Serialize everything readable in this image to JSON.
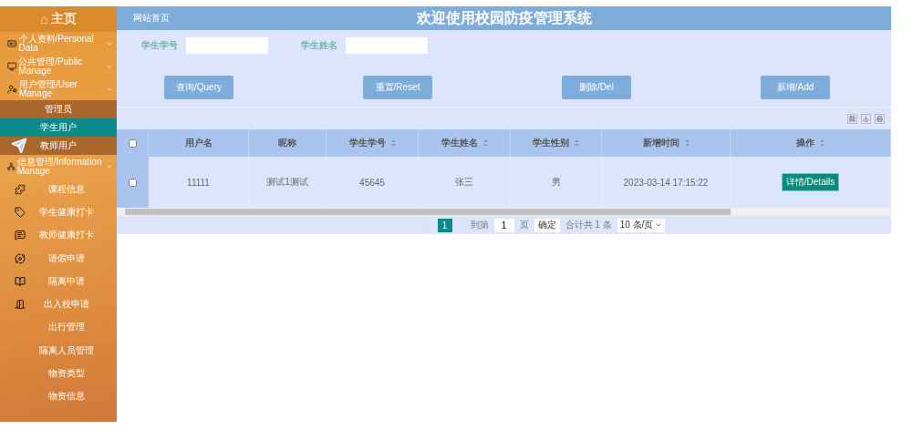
{
  "sidebar": {
    "home": {
      "icon": "⌂",
      "label": "主页"
    },
    "items": [
      {
        "kind": "group",
        "label": "个人资料/Personal Data",
        "expanded": false
      },
      {
        "kind": "group",
        "label": "公共管理/Public Manage",
        "expanded": false
      },
      {
        "kind": "group",
        "label": "用户管理/User Manage",
        "expanded": true,
        "children": [
          {
            "label": "管理员",
            "selected": false
          },
          {
            "label": "学生用户",
            "selected": true
          },
          {
            "label": "教师用户",
            "selected": false
          }
        ]
      },
      {
        "kind": "group",
        "label": "信息管理/Information Manage",
        "expanded": false
      },
      {
        "kind": "item",
        "label": "课程信息"
      },
      {
        "kind": "item",
        "label": "学生健康打卡"
      },
      {
        "kind": "item",
        "label": "教师健康打卡"
      },
      {
        "kind": "item",
        "label": "请假申请"
      },
      {
        "kind": "item",
        "label": "隔离申请"
      },
      {
        "kind": "item",
        "label": "出入校申请"
      },
      {
        "kind": "item",
        "label": "出行管理"
      },
      {
        "kind": "item",
        "label": "隔离人员管理"
      },
      {
        "kind": "item",
        "label": "物资类型"
      },
      {
        "kind": "item",
        "label": "物资信息"
      }
    ]
  },
  "topbar": {
    "breadcrumb": "网站首页",
    "title": "欢迎使用校园防疫管理系统"
  },
  "search": [
    {
      "label": "学生学号"
    },
    {
      "label": "学生姓名"
    }
  ],
  "buttons": [
    "查询/Query",
    "重置/Reset",
    "删除/Del",
    "新增/Add"
  ],
  "table": {
    "columns": [
      {
        "label": "用户名",
        "sortable": false
      },
      {
        "label": "昵称",
        "sortable": false
      },
      {
        "label": "学生学号",
        "sortable": true
      },
      {
        "label": "学生姓名",
        "sortable": true
      },
      {
        "label": "学生性别",
        "sortable": true
      },
      {
        "label": "新增时间",
        "sortable": true
      },
      {
        "label": "操作",
        "sortable": true
      }
    ],
    "header_checked": false,
    "rows": [
      {
        "checked": false,
        "cells": [
          "11111",
          "测试1测试",
          "45645",
          "张三",
          "男",
          "2023-03-14 17:15:22"
        ],
        "action": "详情/Details"
      }
    ]
  },
  "pagination": {
    "pages": [
      {
        "label": "1",
        "selected": true
      }
    ],
    "goto_label": "到第",
    "goto_value": "1",
    "page_unit": "页",
    "confirm": "确定",
    "total": "合计共 1 条",
    "page_size": "10 条/页"
  }
}
